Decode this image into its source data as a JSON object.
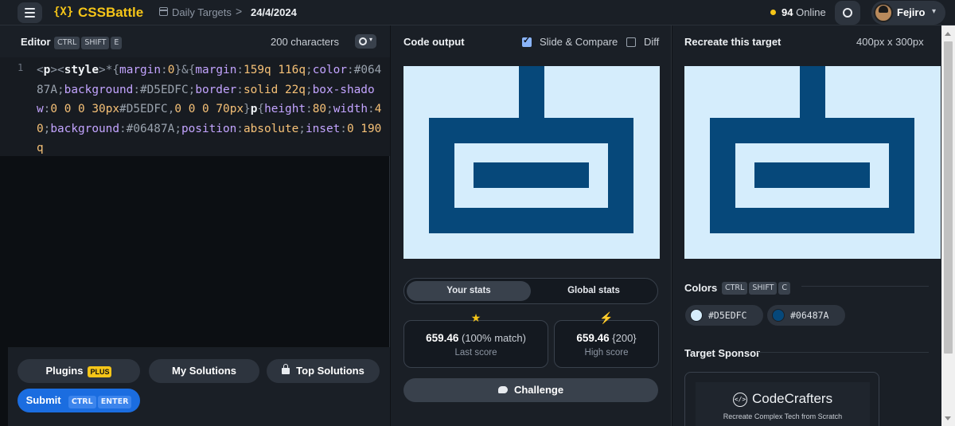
{
  "app": {
    "logo_mark": "{X}",
    "name": "CSSBattle"
  },
  "breadcrumb": {
    "section": "Daily Targets",
    "separator": ">",
    "current": "24/4/2024"
  },
  "topbar": {
    "online_count": "94",
    "online_label": "Online",
    "username": "Fejiro",
    "caret": "▾"
  },
  "editor": {
    "title": "Editor",
    "shortcut_keys": [
      "CTRL",
      "SHIFT",
      "E"
    ],
    "char_count": "200 characters",
    "line_number": "1",
    "code": "<p><style>*{margin:0}&{margin:159q 116q;color:#06487A;background:#D5EDFC;border:solid 22q;box-shadow:0 0 0 30px#D5EDFC,0 0 0 70px}p{height:80;width:40;background:#06487A;position:absolute;inset:0 190q"
  },
  "actions": {
    "plugins": "Plugins",
    "plugins_badge": "PLUS",
    "my_solutions": "My Solutions",
    "top_solutions": "Top Solutions",
    "submit": "Submit",
    "submit_keys": [
      "CTRL",
      "ENTER"
    ]
  },
  "output": {
    "title": "Code output",
    "slide_compare_label": "Slide & Compare",
    "slide_compare_checked": true,
    "diff_label": "Diff",
    "diff_checked": false
  },
  "stats": {
    "tabs": [
      "Your stats",
      "Global stats"
    ],
    "active_tab": "Your stats",
    "last_score_value": "659.46",
    "last_score_extra": "(100% match)",
    "last_score_label": "Last score",
    "high_score_value": "659.46",
    "high_score_extra": "{200}",
    "high_score_label": "High score",
    "star_icon": "★",
    "bolt_icon": "⚡",
    "challenge_label": "Challenge"
  },
  "target": {
    "title": "Recreate this target",
    "size": "400px x 300px",
    "colors_title": "Colors",
    "colors_keys": [
      "CTRL",
      "SHIFT",
      "C"
    ],
    "colors": [
      {
        "hex": "#D5EDFC",
        "label": "#D5EDFC"
      },
      {
        "hex": "#06487A",
        "label": "#06487A"
      }
    ],
    "sponsor_title": "Target Sponsor",
    "sponsor_logo_glyph": "</>",
    "sponsor_name": "CodeCrafters",
    "sponsor_tagline": "Recreate Complex Tech from Scratch"
  },
  "palette": {
    "light": "#D5EDFC",
    "dark": "#06487A",
    "accent": "#F5C518",
    "submit": "#1B6DE0"
  }
}
